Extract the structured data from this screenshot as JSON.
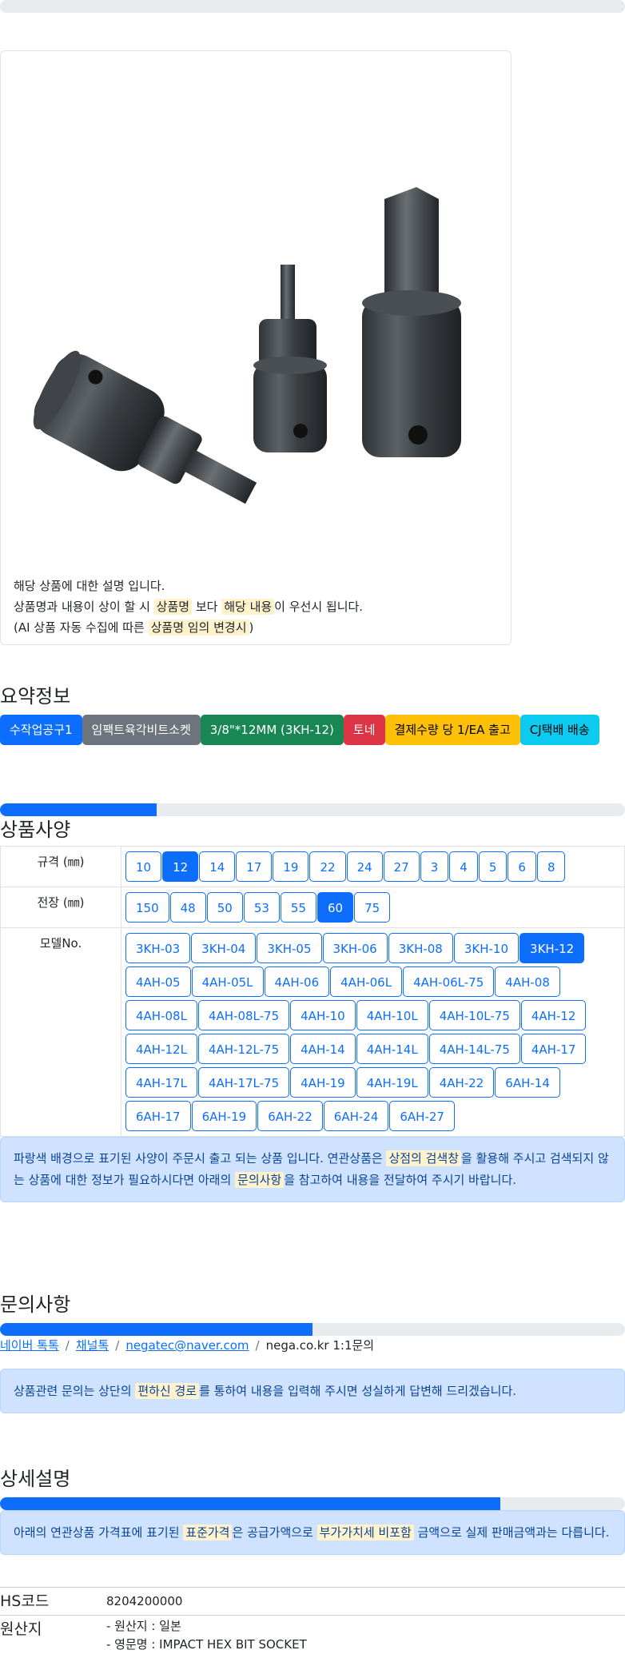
{
  "product": {
    "description_lines": {
      "line1": "해당 상품에 대한 설명 입니다.",
      "line2_a": "상품명과 내용이 상이 할 시 ",
      "line2_hl1": "상품명",
      "line2_b": " 보다 ",
      "line2_hl2": "해당 내용",
      "line2_c": "이 우선시 됩니다.",
      "line3_a": "(AI 상품 자동 수집에 따른 ",
      "line3_hl": "상품명 임의 변경시",
      "line3_b": ")"
    }
  },
  "summary": {
    "title": "요약정보",
    "badges": [
      {
        "label": "수작업공구1",
        "bg": "#0d6efd",
        "fg": "#ffffff"
      },
      {
        "label": "임팩트육각비트소켓",
        "bg": "#6c757d",
        "fg": "#ffffff"
      },
      {
        "label": "3/8\"*12MM (3KH-12)",
        "bg": "#198754",
        "fg": "#ffffff"
      },
      {
        "label": "토네",
        "bg": "#dc3545",
        "fg": "#ffffff"
      },
      {
        "label": "결제수량 당 1/EA 출고",
        "bg": "#ffc107",
        "fg": "#000000"
      },
      {
        "label": "CJ택배 배송",
        "bg": "#0dcaf0",
        "fg": "#000000"
      }
    ]
  },
  "specs": {
    "title": "상품사양",
    "progress": 0.25,
    "rows": [
      {
        "label": "규격 (㎜)",
        "options": [
          "10",
          "12",
          "14",
          "17",
          "19",
          "22",
          "24",
          "27",
          "3",
          "4",
          "5",
          "6",
          "8"
        ],
        "active": "12"
      },
      {
        "label": "전장 (㎜)",
        "options": [
          "150",
          "48",
          "50",
          "53",
          "55",
          "60",
          "75"
        ],
        "active": "60"
      },
      {
        "label": "모델No.",
        "options": [
          "3KH-03",
          "3KH-04",
          "3KH-05",
          "3KH-06",
          "3KH-08",
          "3KH-10",
          "3KH-12",
          "4AH-05",
          "4AH-05L",
          "4AH-06",
          "4AH-06L",
          "4AH-06L-75",
          "4AH-08",
          "4AH-08L",
          "4AH-08L-75",
          "4AH-10",
          "4AH-10L",
          "4AH-10L-75",
          "4AH-12",
          "4AH-12L",
          "4AH-12L-75",
          "4AH-14",
          "4AH-14L",
          "4AH-14L-75",
          "4AH-17",
          "4AH-17L",
          "4AH-17L-75",
          "4AH-19",
          "4AH-19L",
          "4AH-22",
          "6AH-14",
          "6AH-17",
          "6AH-19",
          "6AH-22",
          "6AH-24",
          "6AH-27"
        ],
        "active": "3KH-12"
      }
    ],
    "notice": {
      "a": "파랑색 배경으로 표기된 사양이 주문시 출고 되는 상품 입니다. 연관상품은 ",
      "hl1": "상점의 검색창",
      "b": "을 활용해 주시고 검색되지 않는 상품에 대한 정보가 필요하시다면 아래의 ",
      "hl2": "문의사항",
      "c": "을 참고하여 내용을 전달하여 주시기 바랍니다."
    }
  },
  "inquiry": {
    "title": "문의사항",
    "progress": 0.5,
    "links": [
      "네이버 톡톡",
      "채널톡",
      "negatec@naver.com"
    ],
    "last": "nega.co.kr 1:1문의",
    "separator": "/",
    "notice": {
      "a": "상품관련 문의는 상단의 ",
      "hl": "편하신 경로",
      "b": "를 통하여 내용을 입력해 주시면 성실하게 답변해 드리겠습니다."
    }
  },
  "detail": {
    "title": "상세설명",
    "progress": 0.8,
    "notice": {
      "a": "아래의 연관상품 가격표에 표기된 ",
      "hl1": "표준가격",
      "b": "은 공급가액으로 ",
      "hl2": "부가가치세 비포함",
      "c": " 금액으로 실제 판매금액과는 다릅니다."
    },
    "hs_label": "HS코드",
    "hs_value": "8204200000",
    "origin_label": "원산지",
    "origin_line1": "- 원산지 : 일본",
    "origin_line2": "- 영문명 : IMPACT HEX BIT SOCKET"
  }
}
